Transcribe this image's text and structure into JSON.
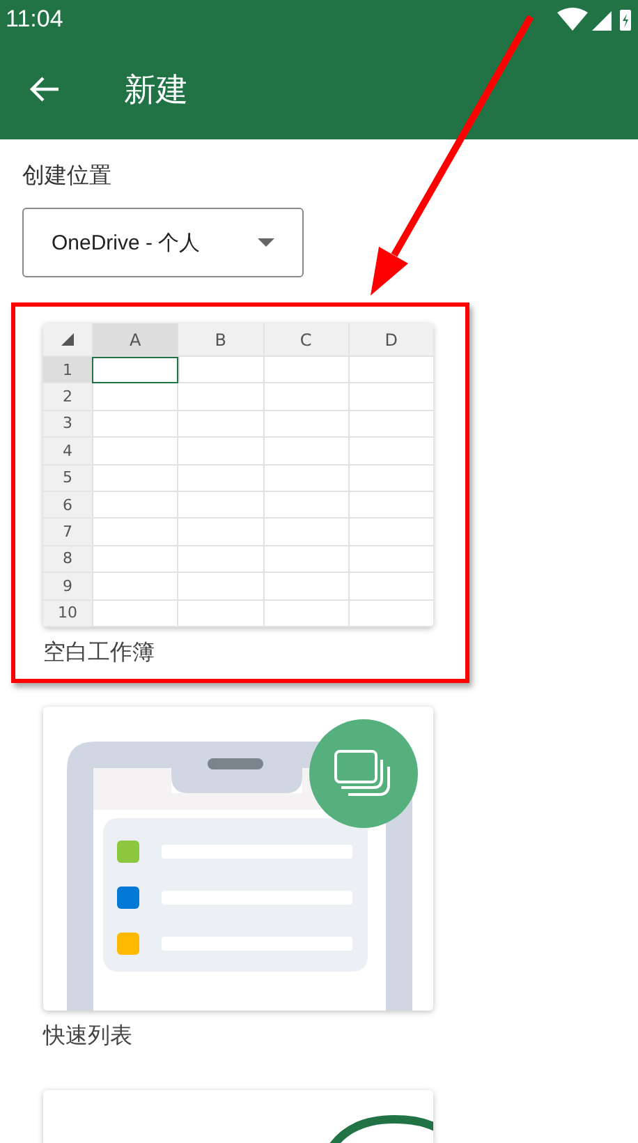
{
  "status_bar": {
    "time": "11:04"
  },
  "app_bar": {
    "title": "新建"
  },
  "location": {
    "label": "创建位置",
    "value": "OneDrive - 个人"
  },
  "templates": [
    {
      "kind": "blank",
      "caption": "空白工作簿",
      "highlighted": true,
      "columns": [
        {
          "label": "A",
          "selected": true
        },
        {
          "label": "B",
          "selected": false
        },
        {
          "label": "C",
          "selected": false
        },
        {
          "label": "D",
          "selected": false
        }
      ],
      "rows": [
        {
          "label": "1",
          "selected": true
        },
        {
          "label": "2",
          "selected": false
        },
        {
          "label": "3",
          "selected": false
        },
        {
          "label": "4",
          "selected": false
        },
        {
          "label": "5",
          "selected": false
        },
        {
          "label": "6",
          "selected": false
        },
        {
          "label": "7",
          "selected": false
        },
        {
          "label": "8",
          "selected": false
        },
        {
          "label": "9",
          "selected": false
        },
        {
          "label": "10",
          "selected": false
        }
      ]
    },
    {
      "kind": "quick-list",
      "caption": "快速列表",
      "highlighted": false,
      "items": [
        {
          "color": "#8dc63f"
        },
        {
          "color": "#0078d4"
        },
        {
          "color": "#ffb900"
        }
      ]
    },
    {
      "kind": "partial",
      "highlighted": false
    }
  ]
}
